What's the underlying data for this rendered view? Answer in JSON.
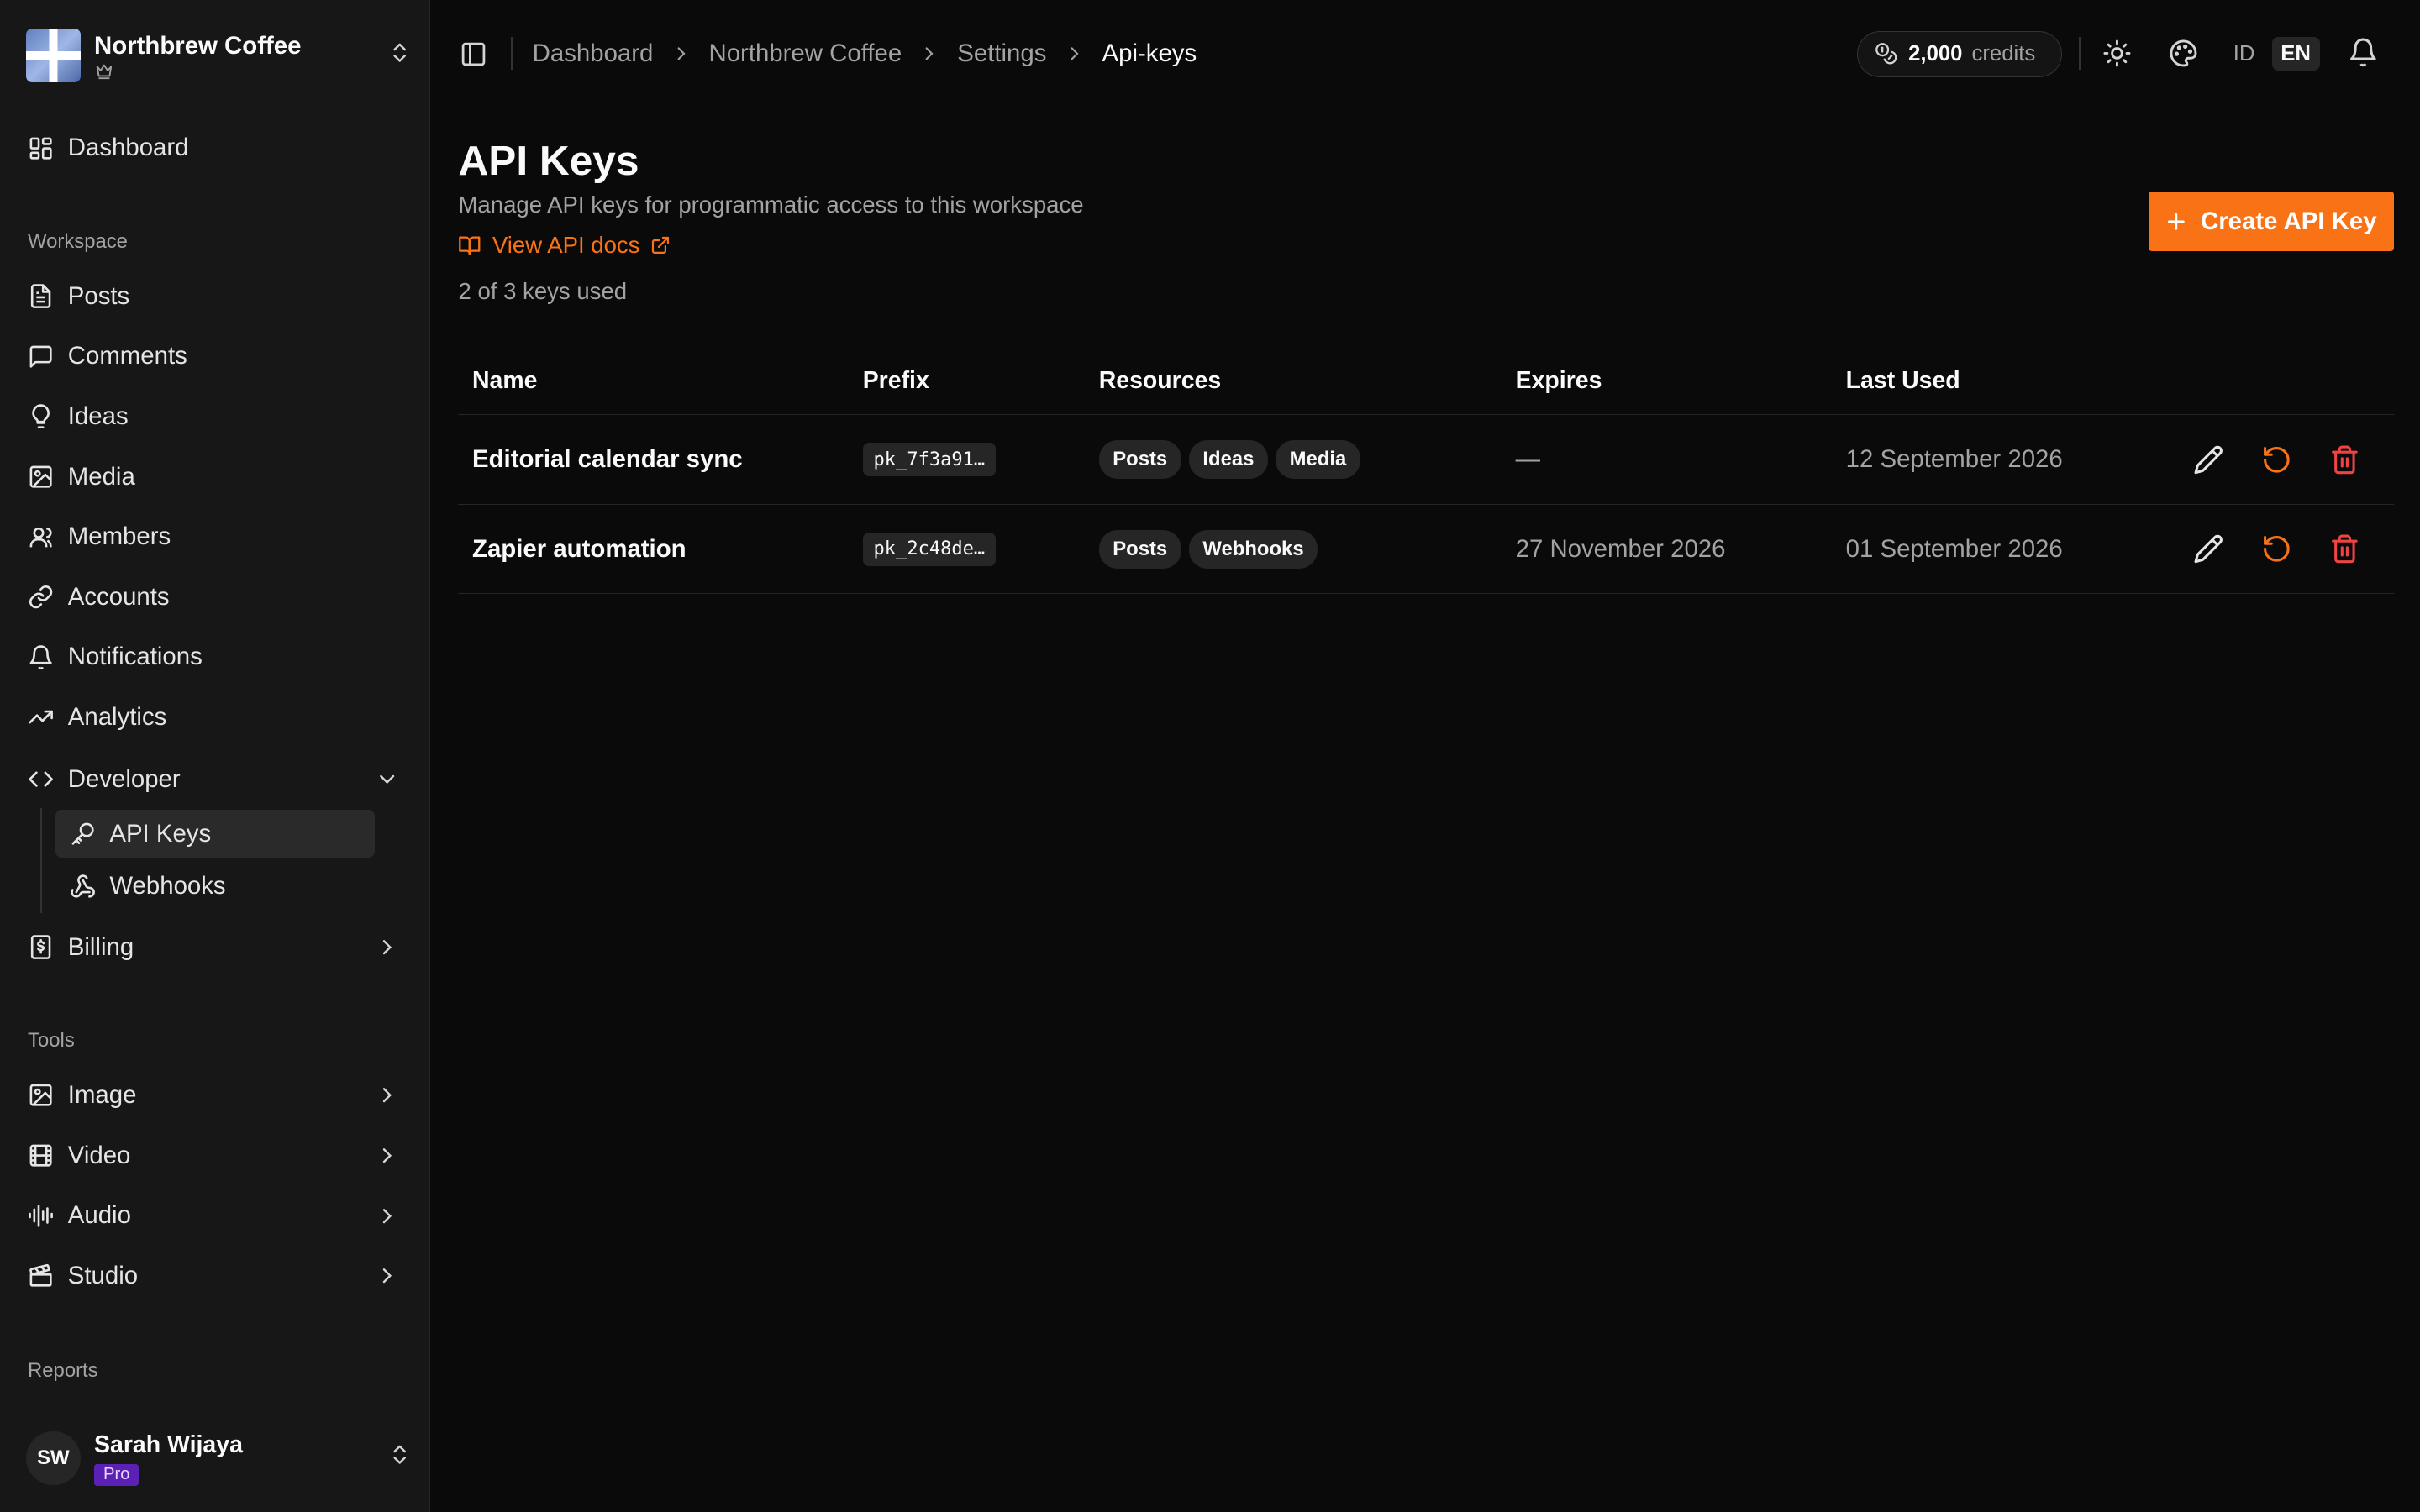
{
  "workspace": {
    "name": "Northbrew Coffee"
  },
  "sidebar": {
    "dashboard": "Dashboard",
    "workspace_label": "Workspace",
    "workspace_items": [
      "Posts",
      "Comments",
      "Ideas",
      "Media",
      "Members",
      "Accounts",
      "Notifications",
      "Analytics"
    ],
    "developer": {
      "label": "Developer",
      "expanded": true,
      "items": [
        "API Keys",
        "Webhooks"
      ],
      "active": "API Keys"
    },
    "billing": "Billing",
    "tools_label": "Tools",
    "tools": [
      "Image",
      "Video",
      "Audio",
      "Studio"
    ],
    "reports_label": "Reports"
  },
  "user": {
    "initials": "SW",
    "name": "Sarah Wijaya",
    "plan": "Pro"
  },
  "topbar": {
    "breadcrumb": [
      "Dashboard",
      "Northbrew Coffee",
      "Settings",
      "Api-keys"
    ],
    "credits_amount": "2,000",
    "credits_unit": "credits",
    "lang_inactive": "ID",
    "lang_active": "EN"
  },
  "page": {
    "title": "API Keys",
    "subtitle": "Manage API keys for programmatic access to this workspace",
    "docs_link": "View API docs",
    "usage": "2 of 3 keys used",
    "create_button": "Create API Key"
  },
  "table": {
    "columns": [
      "Name",
      "Prefix",
      "Resources",
      "Expires",
      "Last Used"
    ],
    "rows": [
      {
        "name": "Editorial calendar sync",
        "prefix": "pk_7f3a91…",
        "resources": [
          "Posts",
          "Ideas",
          "Media"
        ],
        "expires": "—",
        "last_used": "12 September 2026"
      },
      {
        "name": "Zapier automation",
        "prefix": "pk_2c48de…",
        "resources": [
          "Posts",
          "Webhooks"
        ],
        "expires": "27 November 2026",
        "last_used": "01 September 2026"
      }
    ]
  },
  "colors": {
    "accent": "#f97316",
    "danger": "#ef4444",
    "pro_badge": "#5b21b6",
    "background": "#0a0a0a",
    "sidebar": "#171717"
  }
}
